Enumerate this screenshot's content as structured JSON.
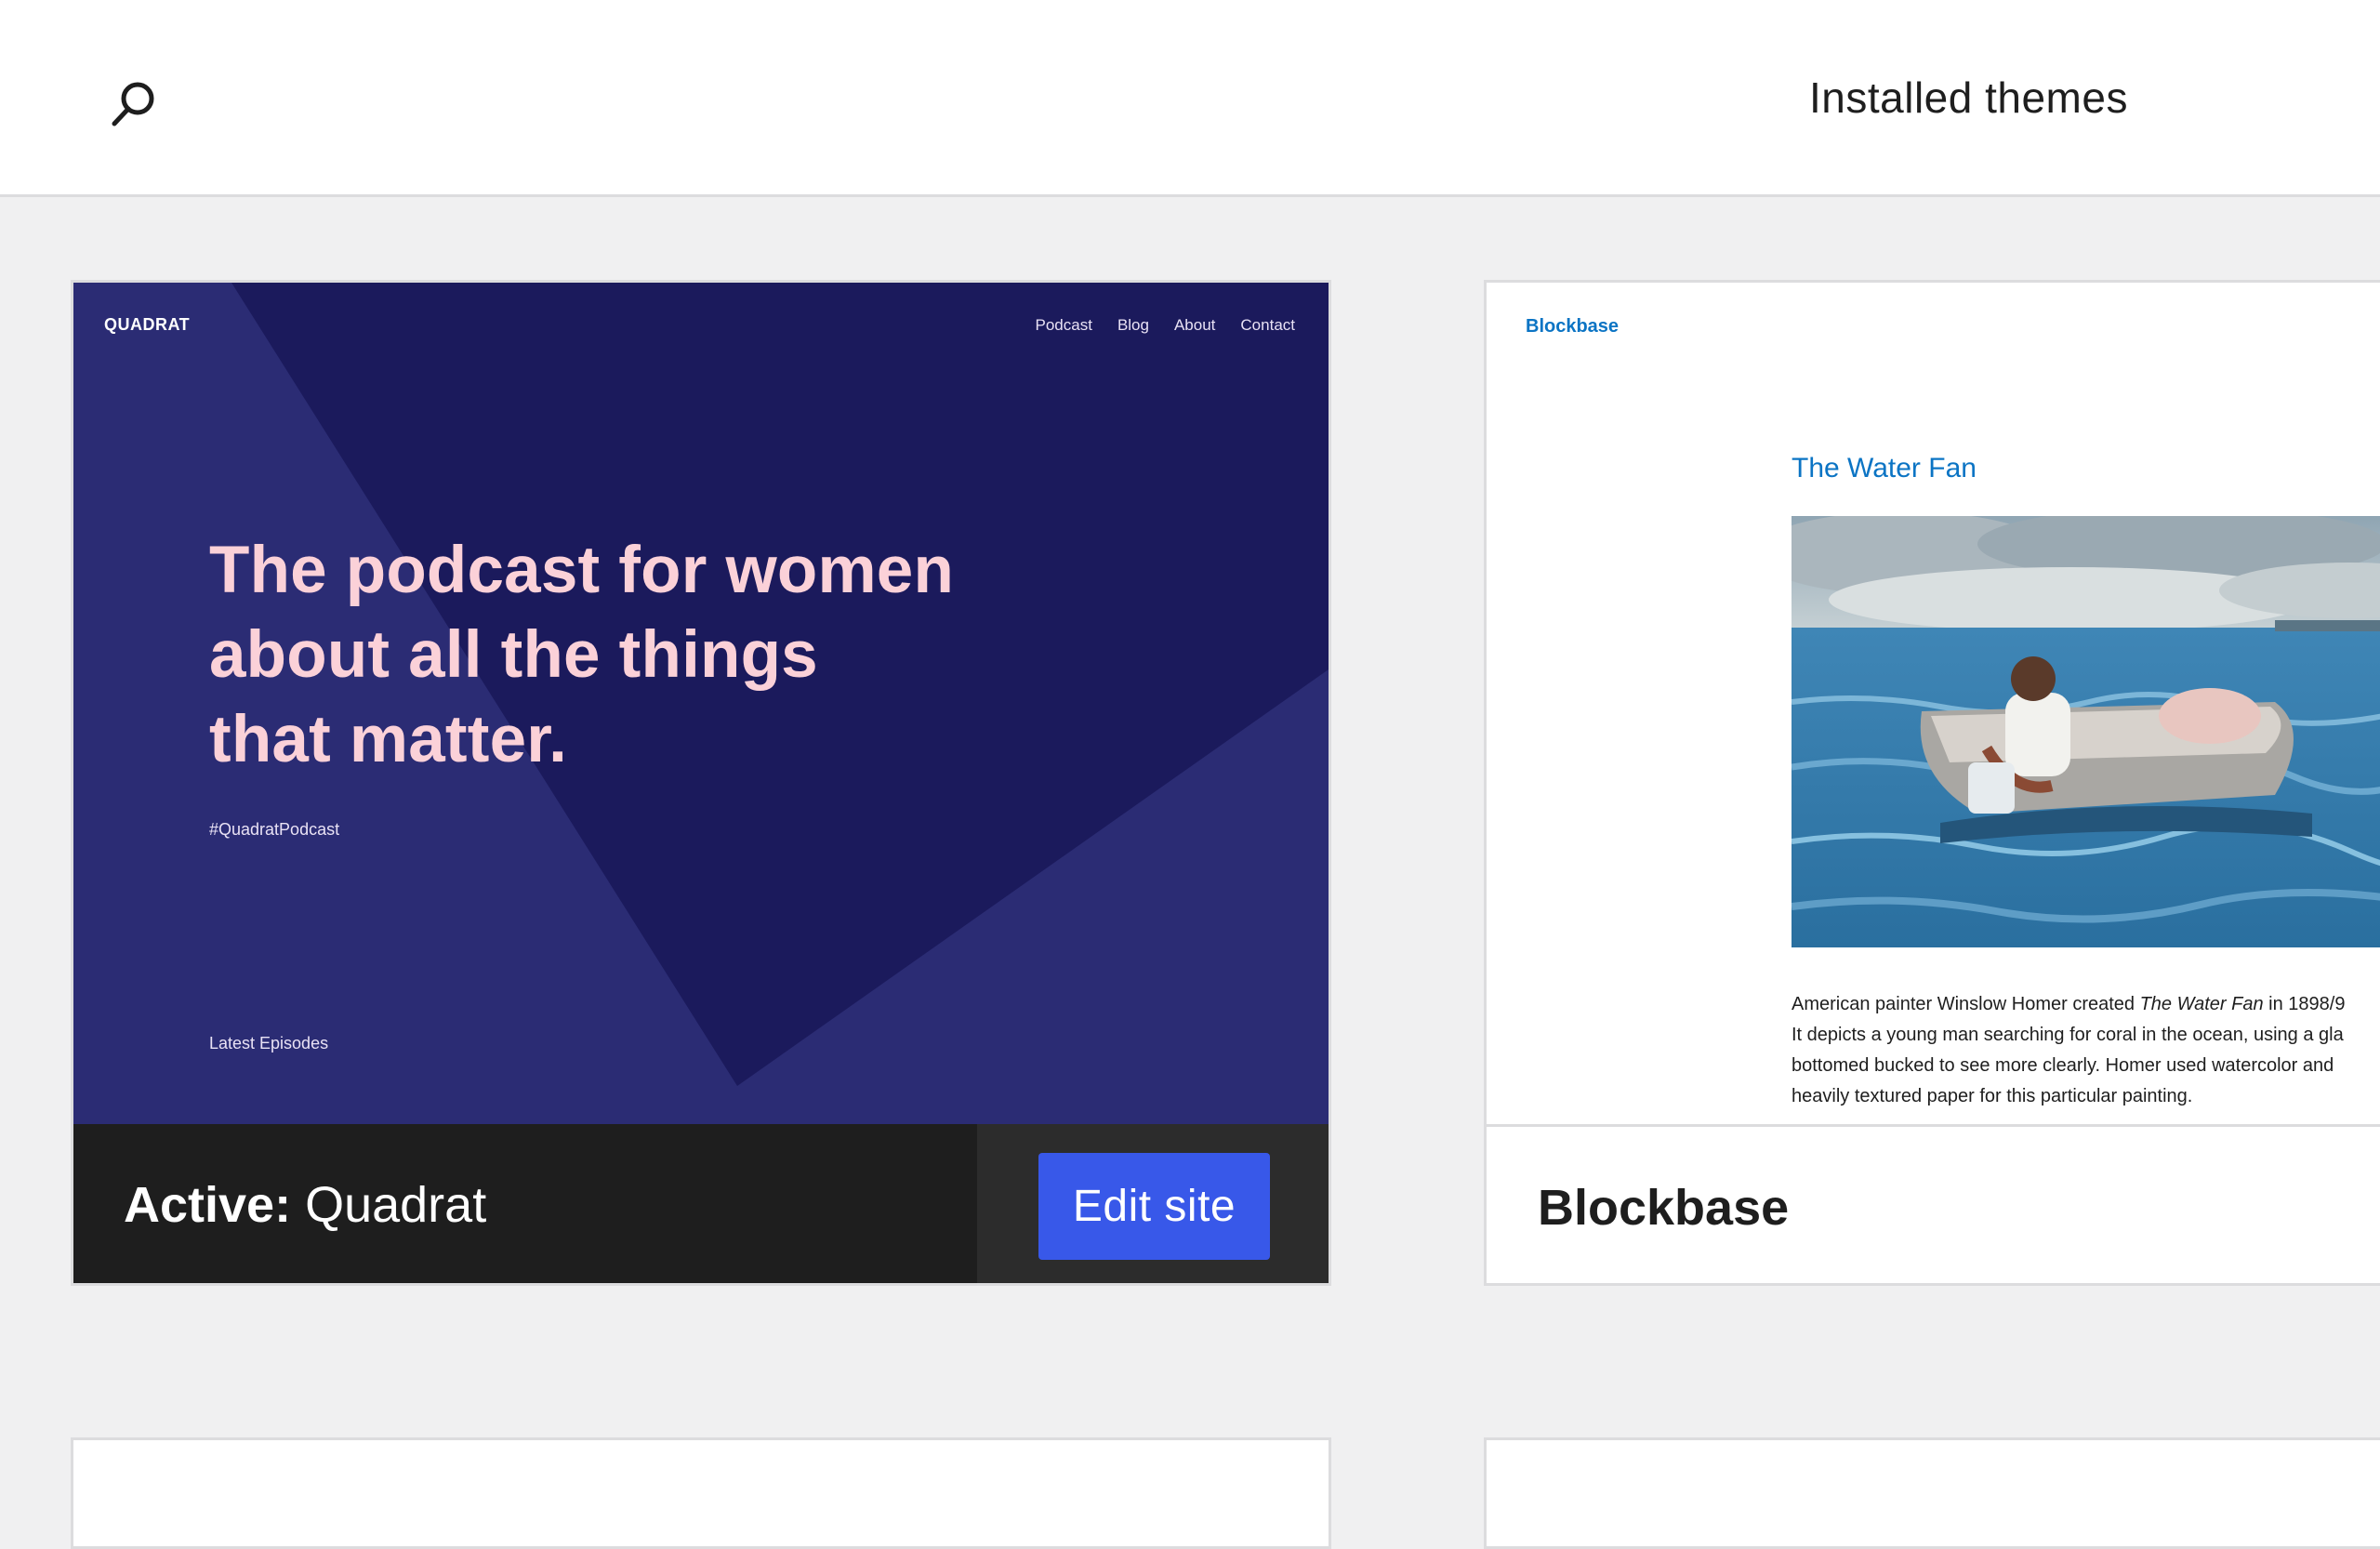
{
  "topbar": {
    "search_icon": "search-icon",
    "title": "Installed themes"
  },
  "themes": [
    {
      "name": "Quadrat",
      "active_prefix": "Active:",
      "action_label": "Edit site",
      "preview": {
        "site_title": "QUADRAT",
        "nav": [
          "Podcast",
          "Blog",
          "About",
          "Contact"
        ],
        "hero_lines": [
          "The podcast for women",
          "about all the things",
          "that matter."
        ],
        "hashtag": "#QuadratPodcast",
        "section_label": "Latest Episodes"
      }
    },
    {
      "name": "Blockbase",
      "preview": {
        "site_title": "Blockbase",
        "post_title": "The Water Fan",
        "paragraph_lines": [
          {
            "before": "American painter Winslow Homer created ",
            "italic": "The Water Fan",
            "after": " in 1898/9"
          },
          {
            "before": "It depicts a young man searching for coral in the ocean, using a gla",
            "italic": "",
            "after": ""
          },
          {
            "before": "bottomed bucked to see more clearly. Homer used watercolor and",
            "italic": "",
            "after": ""
          },
          {
            "before": "heavily textured paper for this particular painting.",
            "italic": "",
            "after": ""
          }
        ]
      }
    }
  ],
  "colors": {
    "accent": "#3858e9",
    "quadrat_bg": "#1b1a5c",
    "quadrat_text": "#fbd1d8",
    "blockbase_link": "#0b74c4"
  }
}
